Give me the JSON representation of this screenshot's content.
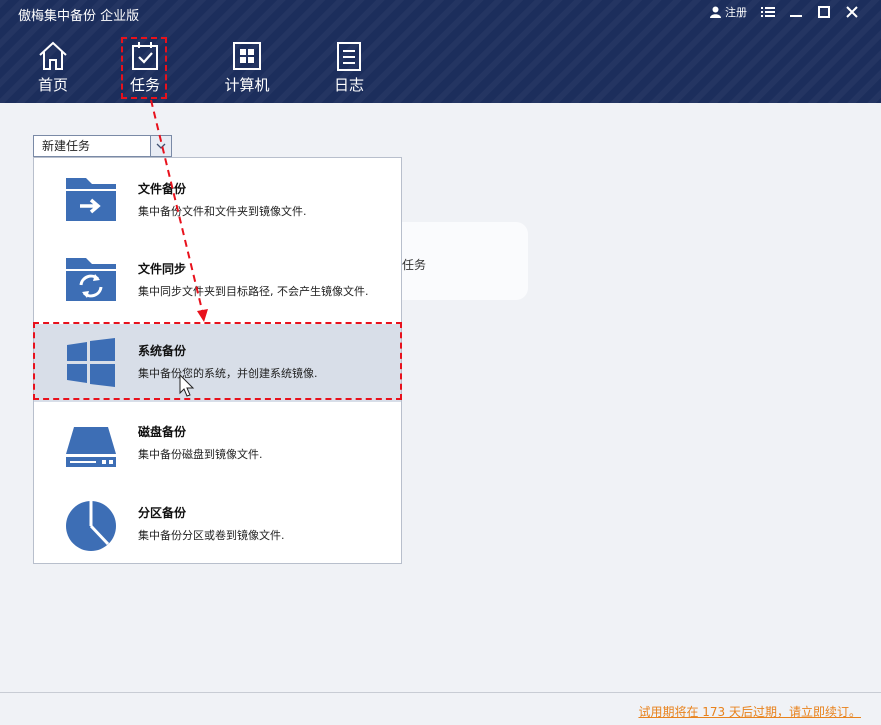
{
  "app": {
    "title": "傲梅集中备份 企业版"
  },
  "window_controls": {
    "register_label": "注册"
  },
  "nav": [
    {
      "label": "首页",
      "icon": "home-icon"
    },
    {
      "label": "任务",
      "icon": "task-calendar-icon"
    },
    {
      "label": "计算机",
      "icon": "computer-windows-icon"
    },
    {
      "label": "日志",
      "icon": "log-document-icon"
    }
  ],
  "new_task": {
    "label": "新建任务"
  },
  "background_card": {
    "text": "任务"
  },
  "task_menu": [
    {
      "title": "文件备份",
      "desc": "集中备份文件和文件夹到镜像文件.",
      "icon": "folder-arrow-icon"
    },
    {
      "title": "文件同步",
      "desc": "集中同步文件夹到目标路径, 不会产生镜像文件.",
      "icon": "folder-sync-icon"
    },
    {
      "title": "系统备份",
      "desc": "集中备份您的系统，并创建系统镜像.",
      "icon": "windows-logo-icon"
    },
    {
      "title": "磁盘备份",
      "desc": "集中备份磁盘到镜像文件.",
      "icon": "disk-drive-icon"
    },
    {
      "title": "分区备份",
      "desc": "集中备份分区或卷到镜像文件.",
      "icon": "partition-pie-icon"
    }
  ],
  "footer": {
    "trial_notice": "试用期将在 173 天后过期，请立即续订。"
  },
  "colors": {
    "header_bg": "#1c2e5c",
    "icon_blue": "#3d6eb5",
    "annotation_red": "#e8111c",
    "trial_orange": "#e8821c"
  }
}
